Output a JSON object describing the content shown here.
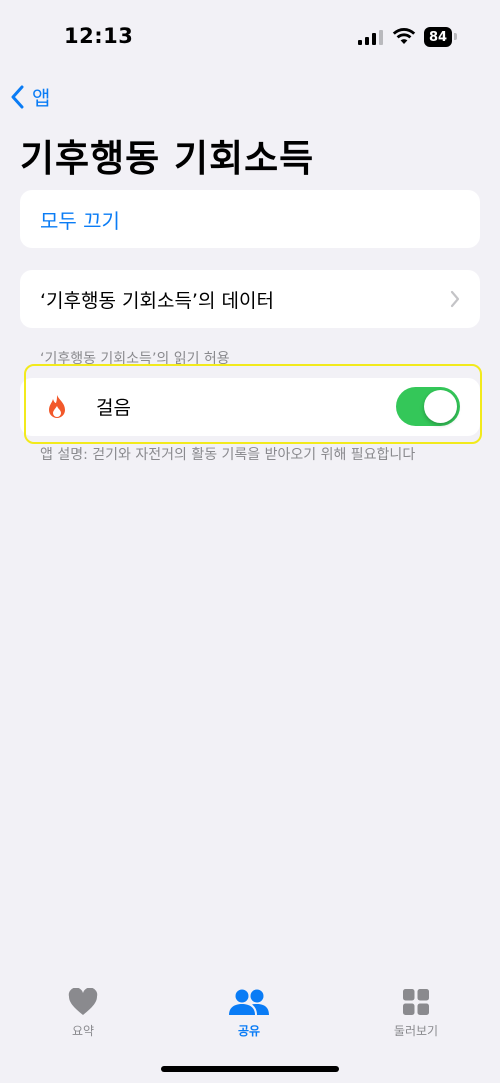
{
  "status_bar": {
    "time": "12:13",
    "battery": "84"
  },
  "nav": {
    "back_label": "앱"
  },
  "page": {
    "title": "기후행동 기회소득"
  },
  "actions": {
    "turn_off_all": "모두 끄기",
    "data_row": "‘기후행동 기회소득’의 데이터"
  },
  "permissions": {
    "section_header": "‘기후행동 기회소득’의 읽기 허용",
    "items": [
      {
        "label": "걸음",
        "icon": "flame-icon",
        "enabled": true
      }
    ],
    "footnote": "앱 설명: 걷기와 자전거의 활동 기록을 받아오기 위해 필요합니다"
  },
  "tabbar": {
    "tabs": [
      {
        "label": "요약",
        "icon": "heart-icon",
        "active": false
      },
      {
        "label": "공유",
        "icon": "people-icon",
        "active": true
      },
      {
        "label": "둘러보기",
        "icon": "grid-icon",
        "active": false
      }
    ]
  },
  "colors": {
    "accent": "#0a7cf5",
    "toggle_on": "#34c759",
    "background": "#f2f1f6",
    "highlight": "#f2ea1c",
    "flame": "#f2582a"
  }
}
